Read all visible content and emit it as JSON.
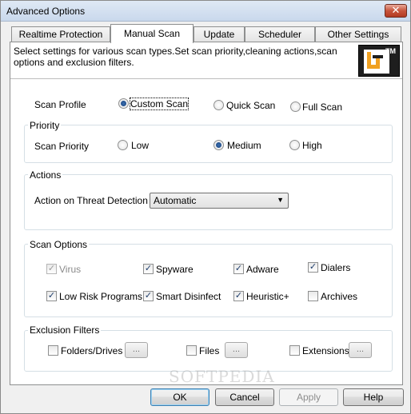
{
  "window": {
    "title": "Advanced Options",
    "close_glyph": "✕"
  },
  "tabs": [
    {
      "label": "Realtime Protection"
    },
    {
      "label": "Manual Scan"
    },
    {
      "label": "Update"
    },
    {
      "label": "Scheduler"
    },
    {
      "label": "Other Settings"
    }
  ],
  "description": "Select settings for various scan types.Set scan priority,cleaning actions,scan options and exclusion filters.",
  "logo": {
    "tm": "TM"
  },
  "scan_profile": {
    "label": "Scan Profile",
    "options": [
      "Custom Scan",
      "Quick Scan",
      "Full Scan"
    ],
    "selected": "Custom Scan"
  },
  "priority": {
    "group_title": "Priority",
    "label": "Scan Priority",
    "options": [
      "Low",
      "Medium",
      "High"
    ],
    "selected": "Medium"
  },
  "actions": {
    "group_title": "Actions",
    "label": "Action on Threat Detection",
    "value": "Automatic"
  },
  "scan_options": {
    "group_title": "Scan Options",
    "items": [
      {
        "label": "Virus",
        "checked": true,
        "disabled": true
      },
      {
        "label": "Spyware",
        "checked": true,
        "disabled": false
      },
      {
        "label": "Adware",
        "checked": true,
        "disabled": false
      },
      {
        "label": "Dialers",
        "checked": true,
        "disabled": false
      },
      {
        "label": "Low Risk Programs",
        "checked": true,
        "disabled": false
      },
      {
        "label": "Smart Disinfect",
        "checked": true,
        "disabled": false
      },
      {
        "label": "Heuristic+",
        "checked": true,
        "disabled": false
      },
      {
        "label": "Archives",
        "checked": false,
        "disabled": false
      }
    ]
  },
  "exclusion": {
    "group_title": "Exclusion Filters",
    "items": [
      {
        "label": "Folders/Drives",
        "checked": false
      },
      {
        "label": "Files",
        "checked": false
      },
      {
        "label": "Extensions",
        "checked": false
      }
    ],
    "browse_label": "..."
  },
  "buttons": {
    "ok": "OK",
    "cancel": "Cancel",
    "apply": "Apply",
    "help": "Help"
  },
  "watermark": "SOFTPEDIA"
}
